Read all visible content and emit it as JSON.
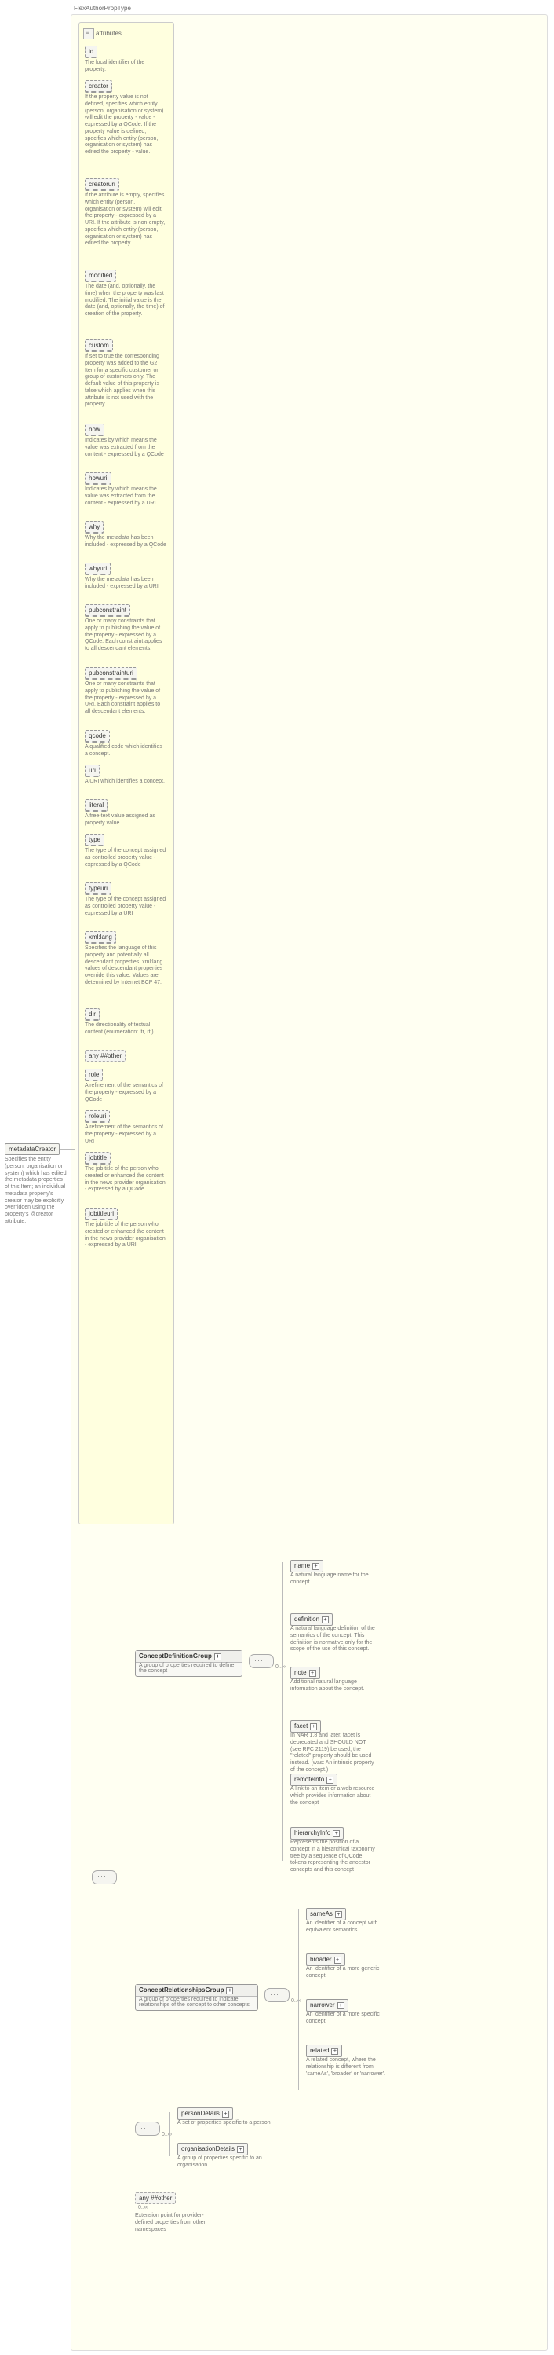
{
  "header": "FlexAuthorPropType",
  "root": {
    "label": "metadataCreator",
    "desc": "Specifies the entity (person, organisation or system) which has edited the metadata properties of this Item; an individual metadata property's creator may be explicitly overridden using the property's @creator attribute."
  },
  "attrs_label": "attributes",
  "attrs": [
    {
      "name": "id",
      "desc": "The local identifier of the property."
    },
    {
      "name": "creator",
      "desc": "If the property value is not defined, specifies which entity (person, organisation or system) will edit the property - value - expressed by a QCode. If the property value is defined, specifies which entity (person, organisation or system) has edited the property - value."
    },
    {
      "name": "creatoruri",
      "desc": "If the attribute is empty, specifies which entity (person, organisation or system) will edit the property - expressed by a URI. If the attribute is non-empty, specifies which entity (person, organisation or system) has edited the property."
    },
    {
      "name": "modified",
      "desc": "The date (and, optionally, the time) when the property was last modified. The initial value is the date (and, optionally, the time) of creation of the property."
    },
    {
      "name": "custom",
      "desc": "If set to true the corresponding property was added to the G2 Item for a specific customer or group of customers only. The default value of this property is false which applies when this attribute is not used with the property."
    },
    {
      "name": "how",
      "desc": "Indicates by which means the value was extracted from the content - expressed by a QCode"
    },
    {
      "name": "howuri",
      "desc": "Indicates by which means the value was extracted from the content - expressed by a URI"
    },
    {
      "name": "why",
      "desc": "Why the metadata has been included - expressed by a QCode"
    },
    {
      "name": "whyuri",
      "desc": "Why the metadata has been included - expressed by a URI"
    },
    {
      "name": "pubconstraint",
      "desc": "One or many constraints that apply to publishing the value of the property - expressed by a QCode. Each constraint applies to all descendant elements."
    },
    {
      "name": "pubconstrainturi",
      "desc": "One or many constraints that apply to publishing the value of the property - expressed by a URI. Each constraint applies to all descendant elements."
    },
    {
      "name": "qcode",
      "desc": "A qualified code which identifies a concept."
    },
    {
      "name": "uri",
      "desc": "A URI which identifies a concept."
    },
    {
      "name": "literal",
      "desc": "A free-text value assigned as property value."
    },
    {
      "name": "type",
      "desc": "The type of the concept assigned as controlled property value - expressed by a QCode"
    },
    {
      "name": "typeuri",
      "desc": "The type of the concept assigned as controlled property value - expressed by a URI"
    },
    {
      "name": "xml:lang",
      "desc": "Specifies the language of this property and potentially all descendant properties. xml:lang values of descendant properties override this value. Values are determined by Internet BCP 47."
    },
    {
      "name": "dir",
      "desc": "The directionality of textual content (enumeration: ltr, rtl)"
    },
    {
      "name": "any",
      "label": "any ##other",
      "desc": ""
    },
    {
      "name": "role",
      "desc": "A refinement of the semantics of the property - expressed by a QCode"
    },
    {
      "name": "roleuri",
      "desc": "A refinement of the semantics of the property - expressed by a URI"
    },
    {
      "name": "jobtitle",
      "desc": "The job title of the person who created or enhanced the content in the news provider organisation - expressed by a QCode"
    },
    {
      "name": "jobtitleuri",
      "desc": "The job title of the person who created or enhanced the content in the news provider organisation - expressed by a URI"
    }
  ],
  "groups": {
    "cdg": {
      "label": "ConceptDefinitionGroup",
      "desc": "A group of properties required to define the concept"
    },
    "crg": {
      "label": "ConceptRelationshipsGroup",
      "desc": "A group of properties required to indicate relationships of the concept to other concepts"
    }
  },
  "cdg_children": [
    {
      "name": "name",
      "desc": "A natural language name for the concept."
    },
    {
      "name": "definition",
      "desc": "A natural language definition of the semantics of the concept. This definition is normative only for the scope of the use of this concept."
    },
    {
      "name": "note",
      "desc": "Additional natural language information about the concept."
    },
    {
      "name": "facet",
      "desc": "In NAR 1.8 and later, facet is deprecated and SHOULD NOT (see RFC 2119) be used, the \"related\" property should be used instead. (was: An intrinsic property of the concept.)"
    },
    {
      "name": "remoteInfo",
      "desc": "A link to an item or a web resource which provides information about the concept"
    },
    {
      "name": "hierarchyInfo",
      "desc": "Represents the position of a concept in a hierarchical taxonomy tree by a sequence of QCode tokens representing the ancestor concepts and this concept"
    }
  ],
  "crg_children": [
    {
      "name": "sameAs",
      "desc": "An identifier of a concept with equivalent semantics"
    },
    {
      "name": "broader",
      "desc": "An identifier of a more generic concept."
    },
    {
      "name": "narrower",
      "desc": "An identifier of a more specific concept."
    },
    {
      "name": "related",
      "desc": "A related concept, where the relationship is different from 'sameAs', 'broader' or 'narrower'."
    }
  ],
  "choice": [
    {
      "name": "personDetails",
      "desc": "A set of properties specific to a person"
    },
    {
      "name": "organisationDetails",
      "desc": "A group of properties specific to an organisation"
    }
  ],
  "ext": {
    "label": "any ##other",
    "desc": "Extension point for provider-defined properties from other namespaces"
  },
  "count": "0..∞"
}
